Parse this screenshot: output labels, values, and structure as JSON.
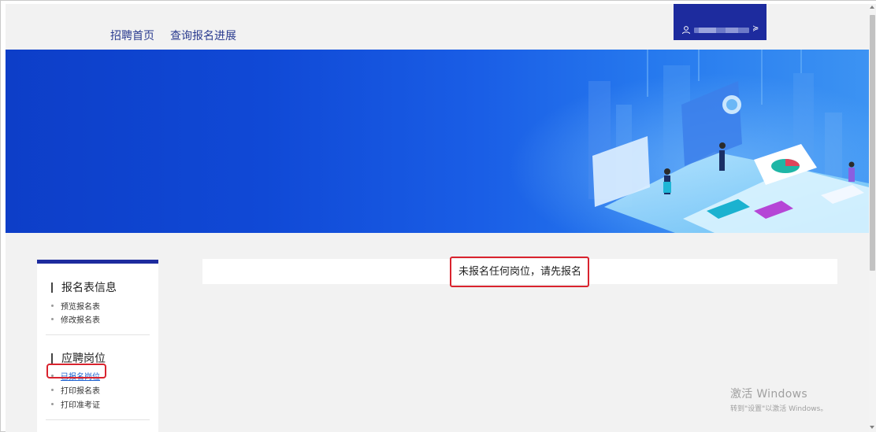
{
  "nav": {
    "home": "招聘首页",
    "progress": "查询报名进展"
  },
  "user": {
    "caret": "≽"
  },
  "sidebar": {
    "section1": {
      "title": "报名表信息",
      "items": [
        "预览报名表",
        "修改报名表"
      ]
    },
    "section2": {
      "title": "应聘岗位",
      "items": [
        "已报名岗位",
        "打印报名表",
        "打印准考证"
      ]
    }
  },
  "notice": {
    "text": "未报名任何岗位，请先报名"
  },
  "watermark": {
    "title": "激活 Windows",
    "subtitle": "转到\"设置\"以激活 Windows。"
  },
  "colors": {
    "brand_dark": "#1d2b9e",
    "banner_start": "#0d3ec8",
    "banner_end": "#3c93f3",
    "highlight": "#d9232e",
    "link_active": "#1e62d0"
  },
  "icons": {
    "user": "user-icon",
    "caret": "double-chevron-down-icon"
  }
}
